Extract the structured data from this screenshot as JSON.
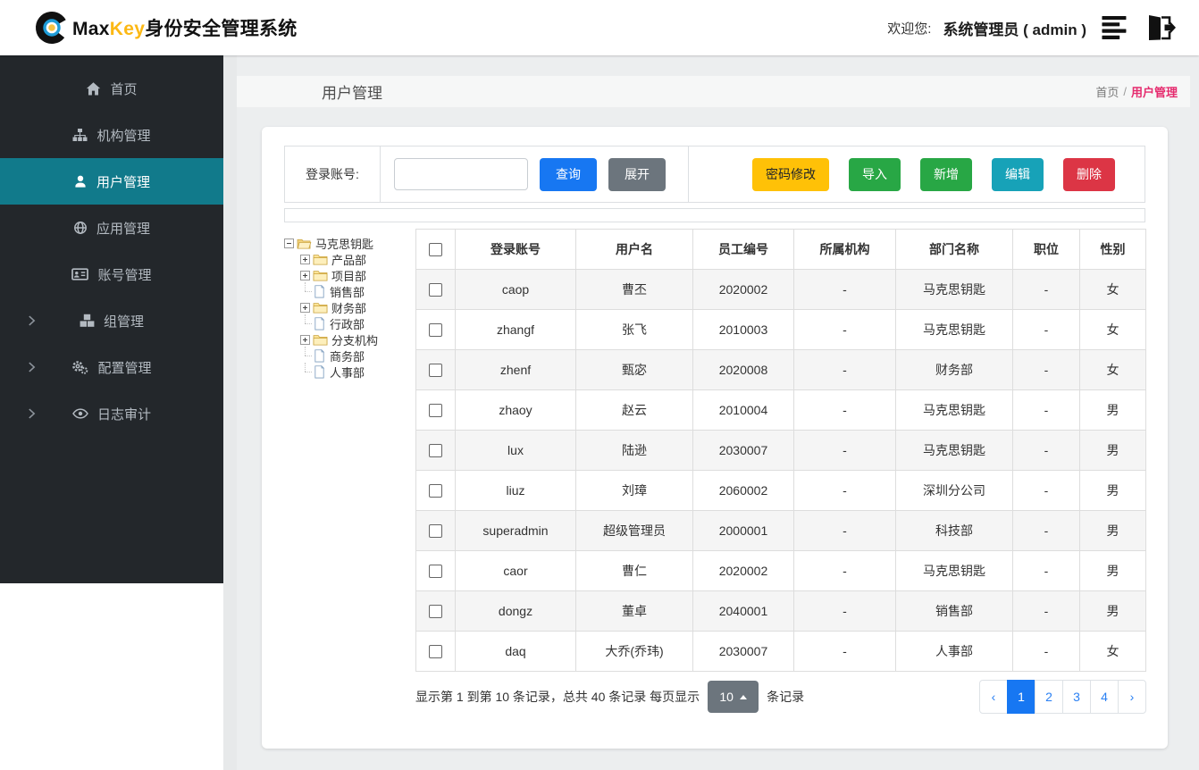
{
  "navbar": {
    "brand": {
      "max": "Max",
      "key": "Key",
      "suffix": "身份安全管理系统"
    },
    "welcome_label": "欢迎您:",
    "user": "系统管理员 ( admin )"
  },
  "sidebar": {
    "items": [
      {
        "name": "home",
        "label": "首页",
        "icon": "home-icon",
        "active": false,
        "chevron": false
      },
      {
        "name": "org",
        "label": "机构管理",
        "icon": "sitemap-icon",
        "active": false,
        "chevron": false
      },
      {
        "name": "user",
        "label": "用户管理",
        "icon": "user-icon",
        "active": true,
        "chevron": false
      },
      {
        "name": "app",
        "label": "应用管理",
        "icon": "globe-icon",
        "active": false,
        "chevron": false
      },
      {
        "name": "account",
        "label": "账号管理",
        "icon": "id-card-icon",
        "active": false,
        "chevron": false
      },
      {
        "name": "group",
        "label": "组管理",
        "icon": "cubes-icon",
        "active": false,
        "chevron": true
      },
      {
        "name": "config",
        "label": "配置管理",
        "icon": "cogs-icon",
        "active": false,
        "chevron": true
      },
      {
        "name": "audit",
        "label": "日志审计",
        "icon": "eye-icon",
        "active": false,
        "chevron": true
      }
    ]
  },
  "page": {
    "title": "用户管理",
    "breadcrumb": {
      "home": "首页",
      "sep": "/",
      "current": "用户管理"
    }
  },
  "toolbar": {
    "search_label": "登录账号:",
    "query_label": "查询",
    "expand_label": "展开",
    "actions": [
      {
        "name": "password-reset",
        "label": "密码修改",
        "style": "warning"
      },
      {
        "name": "import",
        "label": "导入",
        "style": "success"
      },
      {
        "name": "add",
        "label": "新增",
        "style": "success"
      },
      {
        "name": "edit",
        "label": "编辑",
        "style": "info"
      },
      {
        "name": "delete",
        "label": "删除",
        "style": "danger"
      }
    ]
  },
  "tree": {
    "root": {
      "label": "马克思钥匙",
      "icon": "folder-open-icon",
      "toggle": "minus"
    },
    "children": [
      {
        "label": "产品部",
        "icon": "folder-icon",
        "toggle": "plus"
      },
      {
        "label": "项目部",
        "icon": "folder-icon",
        "toggle": "plus"
      },
      {
        "label": "销售部",
        "icon": "file-icon",
        "toggle": "none"
      },
      {
        "label": "财务部",
        "icon": "folder-icon",
        "toggle": "plus"
      },
      {
        "label": "行政部",
        "icon": "file-icon",
        "toggle": "none"
      },
      {
        "label": "分支机构",
        "icon": "folder-icon",
        "toggle": "plus"
      },
      {
        "label": "商务部",
        "icon": "file-icon",
        "toggle": "none"
      },
      {
        "label": "人事部",
        "icon": "file-icon",
        "toggle": "none"
      }
    ]
  },
  "table": {
    "headers": [
      "登录账号",
      "用户名",
      "员工编号",
      "所属机构",
      "部门名称",
      "职位",
      "性别"
    ],
    "rows": [
      [
        "caop",
        "曹丕",
        "2020002",
        "-",
        "马克思钥匙",
        "-",
        "女"
      ],
      [
        "zhangf",
        "张飞",
        "2010003",
        "-",
        "马克思钥匙",
        "-",
        "女"
      ],
      [
        "zhenf",
        "甄宓",
        "2020008",
        "-",
        "财务部",
        "-",
        "女"
      ],
      [
        "zhaoy",
        "赵云",
        "2010004",
        "-",
        "马克思钥匙",
        "-",
        "男"
      ],
      [
        "lux",
        "陆逊",
        "2030007",
        "-",
        "马克思钥匙",
        "-",
        "男"
      ],
      [
        "liuz",
        "刘璋",
        "2060002",
        "-",
        "深圳分公司",
        "-",
        "男"
      ],
      [
        "superadmin",
        "超级管理员",
        "2000001",
        "-",
        "科技部",
        "-",
        "男"
      ],
      [
        "caor",
        "曹仁",
        "2020002",
        "-",
        "马克思钥匙",
        "-",
        "男"
      ],
      [
        "dongz",
        "董卓",
        "2040001",
        "-",
        "销售部",
        "-",
        "男"
      ],
      [
        "daq",
        "大乔(乔玮)",
        "2030007",
        "-",
        "人事部",
        "-",
        "女"
      ]
    ]
  },
  "footer": {
    "summary_prefix": "显示第 1 到第 10 条记录，总共 40 条记录  每页显示",
    "page_size": "10",
    "summary_suffix": "条记录",
    "pagination": {
      "prev": "‹",
      "pages": [
        "1",
        "2",
        "3",
        "4"
      ],
      "active_index": 0,
      "next": "›"
    }
  },
  "colors": {
    "sidebar_bg": "#23272b",
    "sidebar_active_teal": "#117a8b",
    "primary_blue": "#1777f2",
    "success_green": "#28a745",
    "info_teal": "#17a2b8",
    "danger_red": "#dc3545",
    "warning_yellow": "#ffc107",
    "secondary_gray": "#6c757d",
    "breadcrumb_pink": "#e52b6e",
    "brand_yellow": "#fcb814"
  }
}
